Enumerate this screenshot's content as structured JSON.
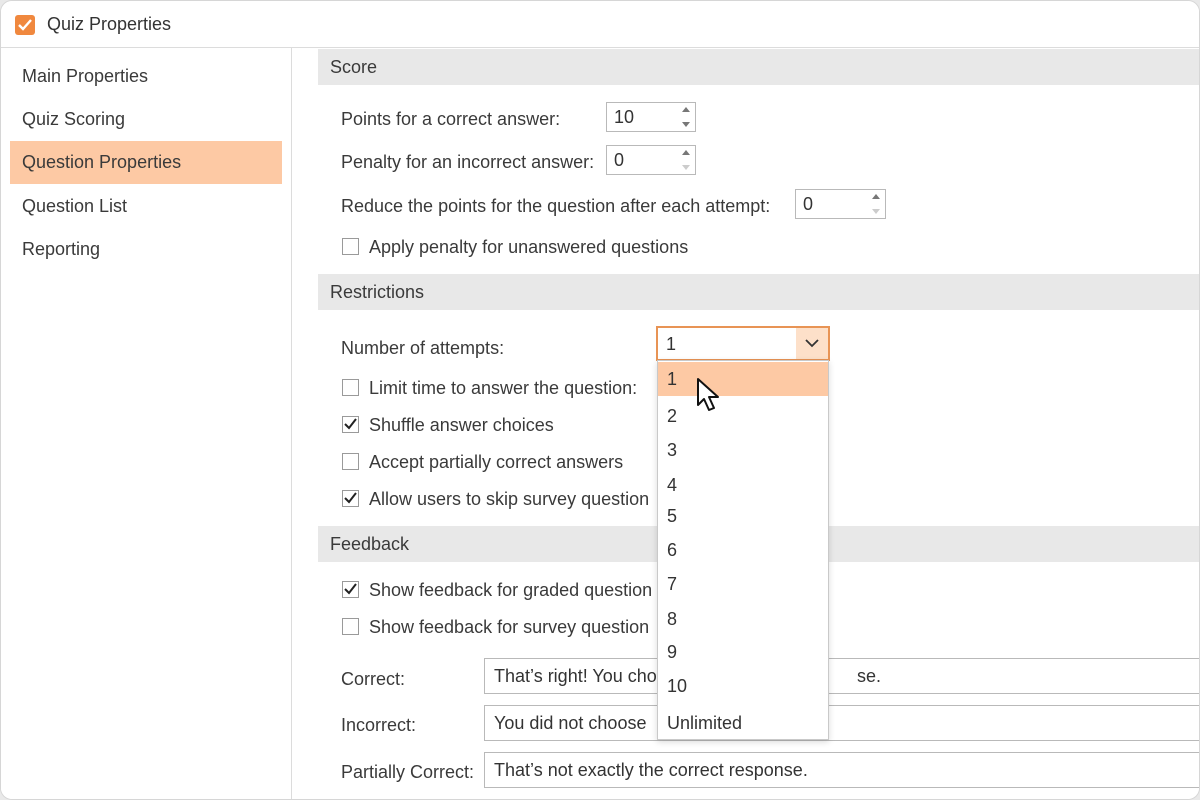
{
  "window": {
    "title": "Quiz Properties"
  },
  "sidebar": {
    "items": [
      {
        "label": "Main Properties"
      },
      {
        "label": "Quiz Scoring"
      },
      {
        "label": "Question Properties"
      },
      {
        "label": "Question List"
      },
      {
        "label": "Reporting"
      }
    ],
    "active_index": 2
  },
  "score": {
    "header": "Score",
    "points_correct_label": "Points for a correct answer:",
    "points_correct_value": "10",
    "penalty_label": "Penalty for an incorrect answer:",
    "penalty_value": "0",
    "reduce_label": "Reduce the points for the question after each attempt:",
    "reduce_value": "0",
    "apply_penalty_label": "Apply penalty for unanswered questions",
    "apply_penalty_checked": false
  },
  "restrictions": {
    "header": "Restrictions",
    "attempts_label": "Number of attempts:",
    "attempts_value": "1",
    "limit_time_label": "Limit time to answer the question:",
    "limit_time_checked": false,
    "shuffle_label": "Shuffle answer choices",
    "shuffle_checked": true,
    "partial_label": "Accept partially correct answers",
    "partial_checked": false,
    "skip_label": "Allow users to skip survey question",
    "skip_checked": true
  },
  "attempts_dropdown": {
    "options": [
      "1",
      "2",
      "3",
      "4",
      "5",
      "6",
      "7",
      "8",
      "9",
      "10",
      "Unlimited"
    ],
    "highlighted_index": 0
  },
  "feedback": {
    "header": "Feedback",
    "graded_label": "Show feedback for graded question",
    "graded_checked": true,
    "survey_label": "Show feedback for survey question",
    "survey_checked": false,
    "correct_label": "Correct:",
    "correct_value": "That’s right! You cho",
    "correct_value_tail": "se.",
    "incorrect_label": "Incorrect:",
    "incorrect_value": "You did not choose",
    "partial_label": "Partially Correct:",
    "partial_value": "That’s not exactly the correct response."
  },
  "colors": {
    "accent": "#f0883e",
    "highlight": "#fdc9a4",
    "section_bg": "#e8e8e8"
  },
  "icons": {
    "title_checkbox": "checkmark-icon",
    "select_arrow": "chevron-down-icon",
    "cursor": "mouse-pointer-icon"
  }
}
